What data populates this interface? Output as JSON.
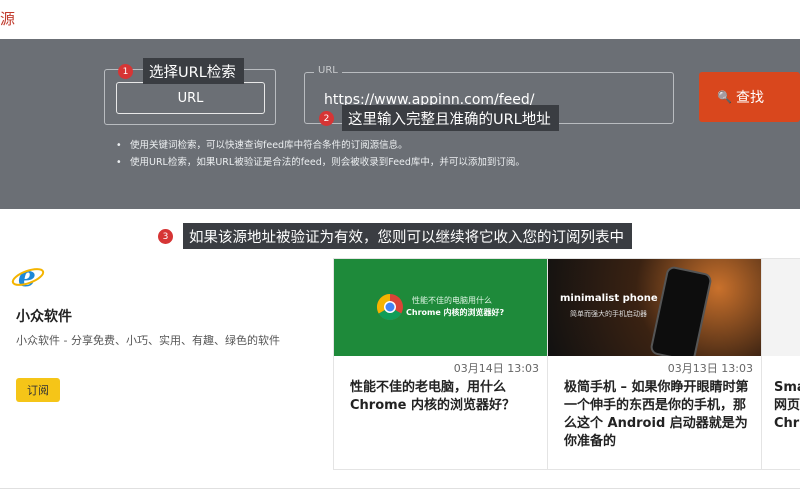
{
  "page": {
    "title_fragment": "源"
  },
  "search": {
    "mode_button": "URL",
    "url_legend": "URL",
    "url_value": "https://www.appinn.com/feed/",
    "search_button": "查找",
    "tips": [
      "使用关键词检索，可以快速查询feed库中符合条件的订阅源信息。",
      "使用URL检索，如果URL被验证是合法的feed，则会被收录到Feed库中，并可以添加到订阅。"
    ]
  },
  "callouts": [
    {
      "num": "1",
      "text": "选择URL检索"
    },
    {
      "num": "2",
      "text": "这里输入完整且准确的URL地址"
    },
    {
      "num": "3",
      "text": "如果该源地址被验证为有效，您则可以继续将它收入您的订阅列表中"
    }
  ],
  "feed": {
    "logo_icon": "ie-logo-icon",
    "name": "小众软件",
    "description": "小众软件 - 分享免费、小巧、实用、有趣、绿色的软件",
    "subscribe": "订阅"
  },
  "articles": [
    {
      "date": "03月14日 13:03",
      "title": "性能不佳的老电脑，用什么 Chrome 内核的浏览器好？",
      "thumb_text_1": "性能不佳的电脑用什么",
      "thumb_text_2": "Chrome 内核的浏览器好?",
      "thumb_color": "#1e8a3a"
    },
    {
      "date": "03月13日 13:03",
      "title": "极简手机 – 如果你睁开眼睛时第一个伸手的东西是你的手机，那么这个 Android 启动器就是为你准备的",
      "thumb_text_1": "minimalist phone",
      "thumb_text_2": "简单而强大的手机启动器",
      "thumb_color": "#2a2a2a"
    },
    {
      "date": "",
      "title": "Sma 网页 Chr",
      "thumb_text_1": "",
      "thumb_text_2": "",
      "thumb_color": "#f3f3f3"
    }
  ]
}
